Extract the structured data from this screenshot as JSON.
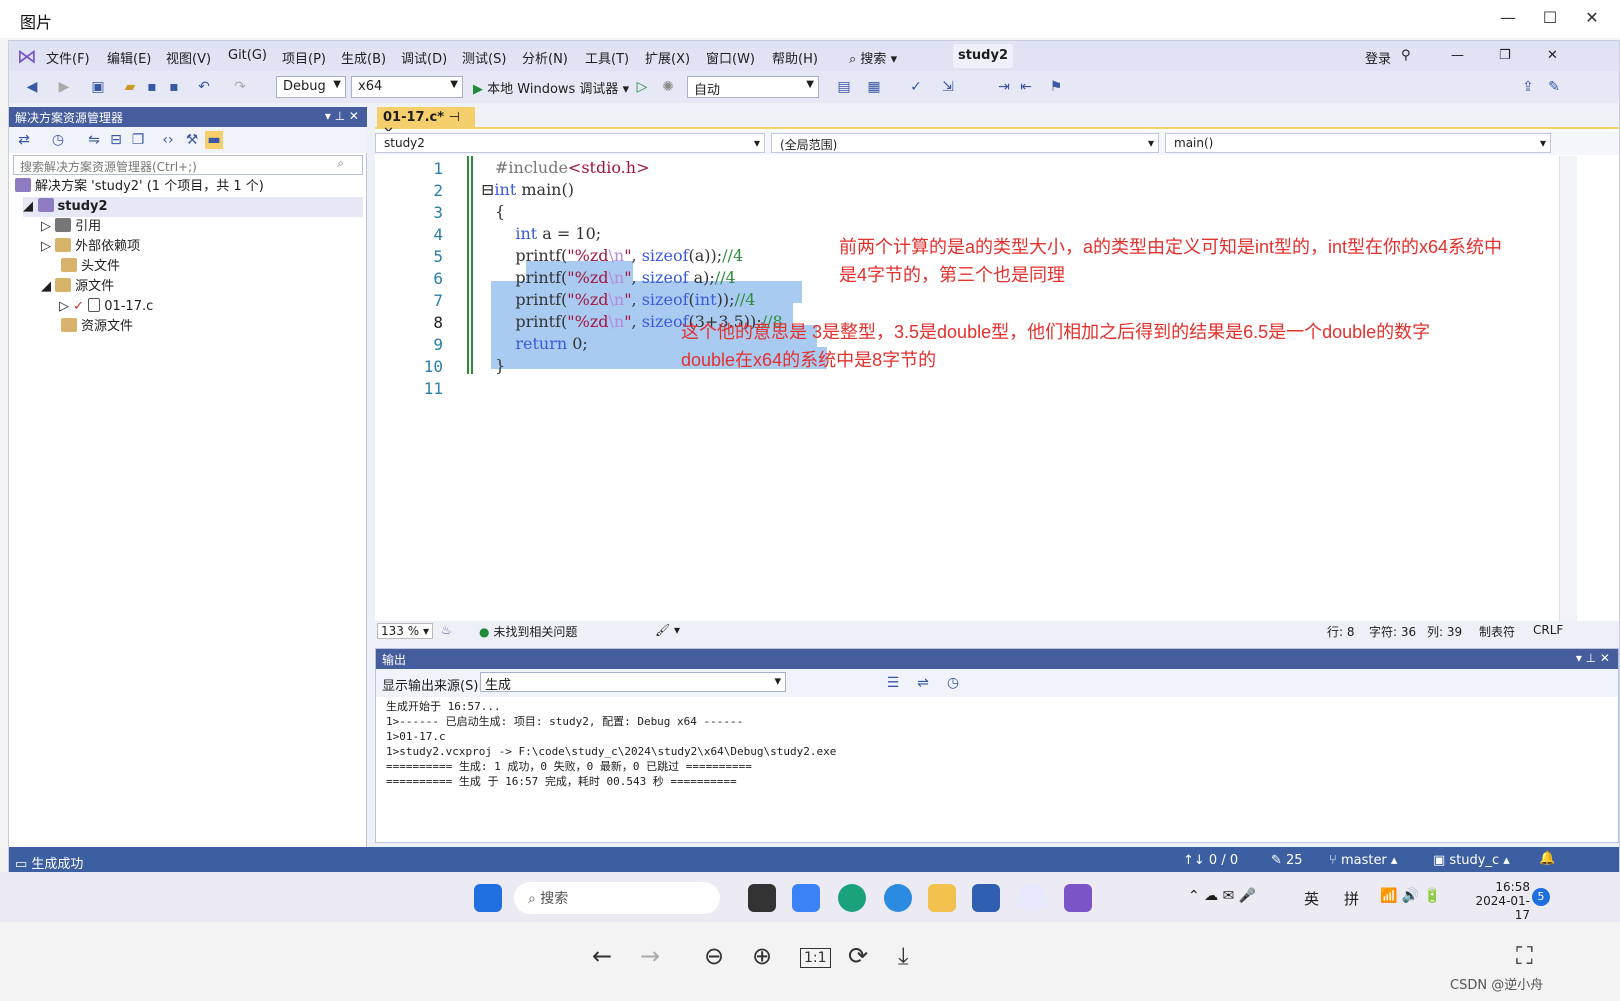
{
  "viewer": {
    "title": "图片",
    "watermark": "CSDN @逆小舟"
  },
  "menu": [
    "文件(F)",
    "编辑(E)",
    "视图(V)",
    "Git(G)",
    "项目(P)",
    "生成(B)",
    "调试(D)",
    "测试(S)",
    "分析(N)",
    "工具(T)",
    "扩展(X)",
    "窗口(W)",
    "帮助(H)"
  ],
  "search_label": "搜索",
  "project": "study2",
  "login": "登录",
  "toolbar": {
    "config": "Debug",
    "platform": "x64",
    "run": "本地 Windows 调试器",
    "auto": "自动"
  },
  "solution_explorer": {
    "title": "解决方案资源管理器",
    "search_placeholder": "搜索解决方案资源管理器(Ctrl+;)",
    "tree": [
      "解决方案 'study2' (1 个项目，共 1 个)",
      "study2",
      "引用",
      "外部依赖项",
      "头文件",
      "源文件",
      "01-17.c",
      "资源文件"
    ]
  },
  "editor": {
    "tab": "01-17.c*",
    "nav_project": "study2",
    "nav_scope": "(全局范围)",
    "nav_func": "main()",
    "lines": [
      "1",
      "2",
      "3",
      "4",
      "5",
      "6",
      "7",
      "8",
      "9",
      "10",
      "11"
    ],
    "zoom": "133 %",
    "issues": "未找到相关问题",
    "row": "行: 8",
    "char": "字符: 36",
    "col": "列: 39",
    "tab_mode": "制表符",
    "eol": "CRLF"
  },
  "annotations": {
    "note1_l1": "前两个计算的是a的类型大小，a的类型由定义可知是int型的，int型在你的x64系统中",
    "note1_l2": "是4字节的，第三个也是同理",
    "note2_l1": "这个他的意思是  3是整型，3.5是double型，他们相加之后得到的结果是6.5是一个double的数字",
    "note2_l2": "double在x64的系统中是8字节的"
  },
  "output": {
    "title": "输出",
    "source_label": "显示输出来源(S):",
    "source_value": "生成",
    "lines": [
      "生成开始于 16:57...",
      "1>------ 已启动生成: 项目: study2, 配置: Debug x64 ------",
      "1>01-17.c",
      "1>study2.vcxproj -> F:\\code\\study_c\\2024\\study2\\x64\\Debug\\study2.exe",
      "========== 生成: 1 成功，0 失败，0 最新，0 已跳过 ==========",
      "========== 生成 于 16:57 完成，耗时 00.543 秒 =========="
    ]
  },
  "statusbar": {
    "left": "生成成功",
    "git_counts": "↑↓ 0 / 0",
    "edits": "25",
    "branch": "master",
    "repo": "study_c",
    "notif": "5"
  },
  "taskbar": {
    "search": "搜索",
    "ime1": "英",
    "ime2": "拼",
    "time": "16:58",
    "date": "2024-01-17"
  }
}
